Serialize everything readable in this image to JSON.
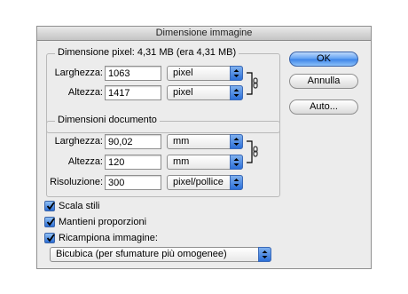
{
  "window": {
    "title": "Dimensione immagine"
  },
  "pixel_dimensions": {
    "legend": "Dimensione pixel:  4,31 MB (era 4,31 MB)",
    "width_label": "Larghezza:",
    "width_value": "1063",
    "width_unit": "pixel",
    "height_label": "Altezza:",
    "height_value": "1417",
    "height_unit": "pixel"
  },
  "document_size": {
    "legend": "Dimensioni documento",
    "width_label": "Larghezza:",
    "width_value": "90,02",
    "width_unit": "mm",
    "height_label": "Altezza:",
    "height_value": "120",
    "height_unit": "mm",
    "resolution_label": "Risoluzione:",
    "resolution_value": "300",
    "resolution_unit": "pixel/pollice"
  },
  "buttons": {
    "ok": "OK",
    "cancel": "Annulla",
    "auto": "Auto..."
  },
  "options": {
    "scale_styles": {
      "label": "Scala stili",
      "checked": true
    },
    "constrain_proportions": {
      "label": "Mantieni proporzioni",
      "checked": true
    },
    "resample": {
      "label": "Ricampiona immagine:",
      "checked": true
    },
    "resample_method": "Bicubica (per sfumature più omogenee)"
  },
  "colors": {
    "accent": "#3b82e8",
    "window_bg": "#ececec"
  },
  "icons": [
    "chain-link-icon",
    "popup-arrows-icon",
    "checkmark-icon"
  ]
}
